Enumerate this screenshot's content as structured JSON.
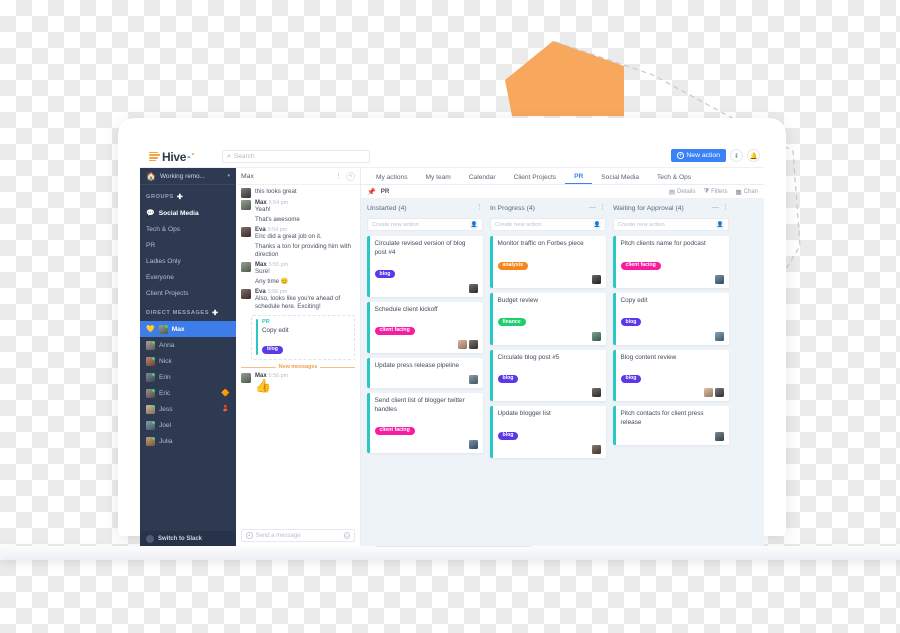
{
  "app": {
    "logo_text": "Hive",
    "logo_dash": "-",
    "search_placeholder": "Search",
    "new_action_label": "New action",
    "new_action_color": "#3b82f6",
    "icons": {
      "search": "search-icon",
      "import": "import-icon",
      "bell": "bell-icon"
    }
  },
  "sidebar": {
    "status": {
      "emoji": "🏠",
      "text": "Working remo...",
      "caret": "▾"
    },
    "groups_header": "GROUPS",
    "groups_add": "✚",
    "groups": [
      {
        "label": "Social Media",
        "emoji": "💬",
        "active": true
      },
      {
        "label": "Tech & Ops",
        "emoji": "",
        "active": false
      },
      {
        "label": "PR",
        "emoji": "",
        "active": false
      },
      {
        "label": "Ladies Only",
        "emoji": "",
        "active": false
      },
      {
        "label": "Everyone",
        "emoji": "",
        "active": false
      },
      {
        "label": "Client Projects",
        "emoji": "",
        "active": false
      }
    ],
    "dm_header": "DIRECT MESSAGES",
    "dm_add": "✚",
    "dms": [
      {
        "label": "Max",
        "selected": true,
        "emoji": "💛",
        "trailing": "",
        "av": "#6d7f6a"
      },
      {
        "label": "Anna",
        "selected": false,
        "emoji": "",
        "trailing": "",
        "av": "#8b7f78"
      },
      {
        "label": "Nick",
        "selected": false,
        "emoji": "",
        "trailing": "",
        "av": "#a05c42"
      },
      {
        "label": "Erin",
        "selected": false,
        "emoji": "",
        "trailing": "",
        "av": "#555f6b"
      },
      {
        "label": "Eric",
        "selected": false,
        "emoji": "",
        "trailing": "🔶",
        "av": "#7a6a5c"
      },
      {
        "label": "Jess",
        "selected": false,
        "emoji": "",
        "trailing": "💄",
        "av": "#c49a7e"
      },
      {
        "label": "Joel",
        "selected": false,
        "emoji": "",
        "trailing": "",
        "av": "#5d7a8c"
      },
      {
        "label": "Julia",
        "selected": false,
        "emoji": "",
        "trailing": "",
        "av": "#b07a4e"
      }
    ],
    "switch_to_slack": "Switch to Slack"
  },
  "chat": {
    "title": "Max",
    "more_icon": "more-vertical-icon",
    "collapse_icon": "collapse-left-icon",
    "messages": [
      {
        "type": "text",
        "author": "",
        "time": "",
        "avatar": "#4a4a4a",
        "text": "this looks great"
      },
      {
        "type": "text",
        "author": "Max",
        "time": "5:54 pm",
        "avatar": "#6d7f6a",
        "text": "Yeah!"
      },
      {
        "type": "cont",
        "text": "That's awesome"
      },
      {
        "type": "text",
        "author": "Eva",
        "time": "5:54 pm",
        "avatar": "#4e3a38",
        "text": "Eric did a great job on it."
      },
      {
        "type": "cont",
        "text": "Thanks a ton for providing him with direction"
      },
      {
        "type": "text",
        "author": "Max",
        "time": "5:55 pm",
        "avatar": "#6d7f6a",
        "text": "Sure!"
      },
      {
        "type": "cont",
        "text": "Any time 😊"
      },
      {
        "type": "text",
        "author": "Eva",
        "time": "5:56 pm",
        "avatar": "#4e3a38",
        "text": "Also, looks like you're ahead of schedule here. Exciting!"
      }
    ],
    "shared_card": {
      "project": "PR",
      "title": "Copy edit",
      "tag": {
        "label": "blog",
        "color": "#5b38e8"
      },
      "avatar": "#5a7f9a"
    },
    "new_messages_label": "New messages",
    "last_message": {
      "author": "Max",
      "time": "5:56 pm",
      "avatar": "#6d7f6a",
      "emoji": "👍"
    },
    "composer": {
      "placeholder": "Send a message",
      "left_icon": "plus-circle-icon",
      "right_icon": "emoji-icon"
    }
  },
  "board": {
    "tabs": [
      {
        "label": "My actions",
        "active": false
      },
      {
        "label": "My team",
        "active": false
      },
      {
        "label": "Calendar",
        "active": false
      },
      {
        "label": "Client Projects",
        "active": false
      },
      {
        "label": "PR",
        "active": true
      },
      {
        "label": "Social Media",
        "active": false
      },
      {
        "label": "Tech & Ops",
        "active": false
      }
    ],
    "project_name": "PR",
    "pin_icon": "pin-icon",
    "toolbar": [
      {
        "label": "Details",
        "icon": "details-icon"
      },
      {
        "label": "Filters",
        "icon": "filter-icon"
      },
      {
        "label": "Chan",
        "icon": "columns-icon"
      }
    ],
    "new_action_placeholder": "Create new action",
    "columns": [
      {
        "title": "Unstarted (4)",
        "has_minimize": false,
        "cards": [
          {
            "title": "Circulate revised version of blog post #4",
            "tag": {
              "label": "blog",
              "color": "#5b38e8"
            },
            "avatars": [
              "#3c3a36"
            ]
          },
          {
            "title": "Schedule client kickoff",
            "tag": {
              "label": "client facing",
              "color": "#f81ca0"
            },
            "avatars": [
              "#cf9f7e",
              "#4a4038"
            ]
          },
          {
            "title": "Update press release pipeline",
            "tag": null,
            "avatars": [
              "#5f7a86"
            ]
          },
          {
            "title": "Send client list of blogger twitter handles",
            "tag": {
              "label": "client facing",
              "color": "#f81ca0"
            },
            "avatars": [
              "#46688a"
            ]
          }
        ]
      },
      {
        "title": "In Progress (4)",
        "has_minimize": true,
        "cards": [
          {
            "title": "Monitor traffic on Forbes piece",
            "tag": {
              "label": "analysis",
              "color": "#f8861c"
            },
            "avatars": [
              "#2e2e2e"
            ]
          },
          {
            "title": "Budget review",
            "tag": {
              "label": "finance",
              "color": "#1fcf6d"
            },
            "avatars": [
              "#4e7b6a"
            ]
          },
          {
            "title": "Circulate blog post #5",
            "tag": {
              "label": "blog",
              "color": "#5b38e8"
            },
            "avatars": [
              "#3c3a36"
            ]
          },
          {
            "title": "Update blogger list",
            "tag": {
              "label": "blog",
              "color": "#5b38e8"
            },
            "avatars": [
              "#5a4a3c"
            ]
          }
        ]
      },
      {
        "title": "Waiting for Approval (4)",
        "has_minimize": true,
        "cards": [
          {
            "title": "Pitch clients name for podcast",
            "tag": {
              "label": "client facing",
              "color": "#f81ca0"
            },
            "avatars": [
              "#46688a"
            ]
          },
          {
            "title": "Copy edit",
            "tag": {
              "label": "blog",
              "color": "#5b38e8"
            },
            "avatars": [
              "#5a7f9a"
            ]
          },
          {
            "title": "Blog content review",
            "tag": {
              "label": "blog",
              "color": "#5b38e8"
            },
            "avatars": [
              "#d2ab86",
              "#46444a"
            ]
          },
          {
            "title": "Pitch contacts for client press release",
            "tag": null,
            "avatars": [
              "#4a5c6a"
            ]
          }
        ]
      }
    ]
  },
  "decorations": {
    "pentagon_fill": "#f8a85c",
    "dashed_stroke": "#c4c8cf",
    "card_accent": "#2bc6c6"
  }
}
